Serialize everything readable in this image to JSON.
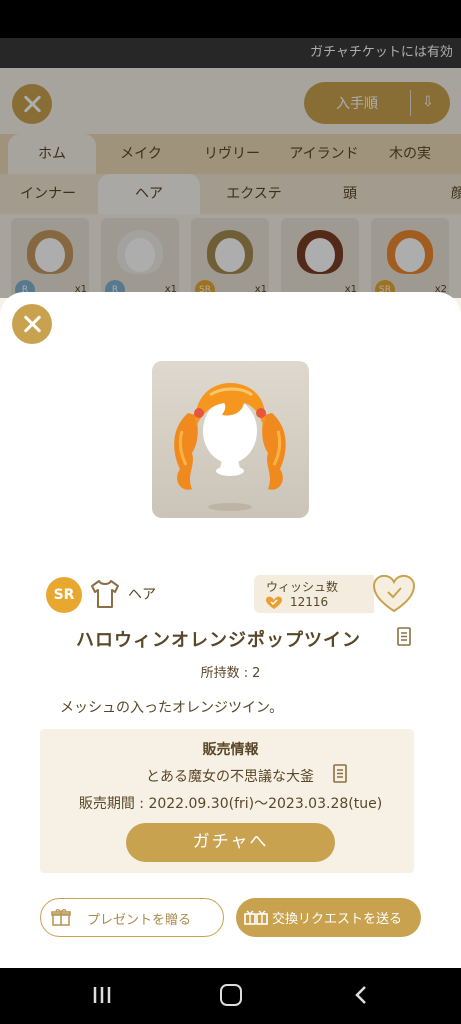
{
  "marquee": "ガチャチケットには有効",
  "background": {
    "sort_label": "入手順",
    "tabs_primary": [
      "ホム",
      "メイク",
      "リヴリー",
      "アイランド",
      "木の実"
    ],
    "tabs_secondary": [
      "インナー",
      "ヘア",
      "エクステ",
      "頭",
      "顔"
    ],
    "thumbnails": [
      {
        "rarity": "R",
        "count": "x1",
        "hair_color": "#c59a5f",
        "badge_color": "#7fb3d5"
      },
      {
        "rarity": "R",
        "count": "x1",
        "hair_color": "#f2efe9",
        "badge_color": "#7fb3d5"
      },
      {
        "rarity": "SR",
        "count": "x1",
        "hair_color": "#a58b52",
        "badge_color": "#e8a830"
      },
      {
        "rarity": "",
        "count": "x1",
        "hair_color": "#7a3e22",
        "badge_color": ""
      },
      {
        "rarity": "SR",
        "count": "x2",
        "hair_color": "#ee8a2e",
        "badge_color": "#e8a830"
      }
    ]
  },
  "item": {
    "rarity": "SR",
    "category": "ヘア",
    "name": "ハロウィンオレンジポップツイン",
    "owned_label": "所持数 :",
    "owned_count": "2",
    "description": "メッシュの入ったオレンジツイン。",
    "image_icon": "orange-twin-tail-hair-icon"
  },
  "wish": {
    "label": "ウィッシュ数",
    "count": "12116"
  },
  "sale": {
    "title": "販売情報",
    "gacha_name": "とある魔女の不思議な大釜",
    "period": "販売期間 : 2022.09.30(fri)〜2023.03.28(tue)",
    "gacha_button": "ガチャへ"
  },
  "actions": {
    "present_label": "プレゼントを贈る",
    "trade_label": "交換リクエストを送る"
  },
  "colors": {
    "accent": "#c9a24f",
    "rarity_sr": "#e8a830",
    "text": "#5a4628"
  }
}
